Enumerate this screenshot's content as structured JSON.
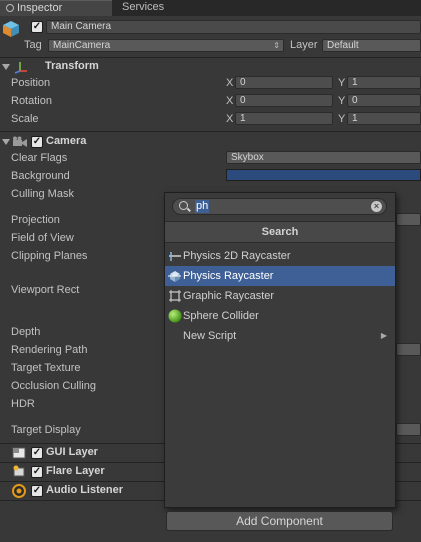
{
  "tabs": [
    {
      "label": "Inspector",
      "active": true
    },
    {
      "label": "Services",
      "active": false
    }
  ],
  "header": {
    "object_name": "Main Camera",
    "tag_label": "Tag",
    "tag_value": "MainCamera",
    "layer_label": "Layer",
    "layer_value": "Default"
  },
  "transform": {
    "title": "Transform",
    "rows": [
      {
        "label": "Position",
        "x_label": "X",
        "x": "0",
        "y_label": "Y",
        "y": "1"
      },
      {
        "label": "Rotation",
        "x_label": "X",
        "x": "0",
        "y_label": "Y",
        "y": "0"
      },
      {
        "label": "Scale",
        "x_label": "X",
        "x": "1",
        "y_label": "Y",
        "y": "1"
      }
    ]
  },
  "camera": {
    "title": "Camera",
    "clear_flags_label": "Clear Flags",
    "clear_flags_value": "Skybox",
    "background_label": "Background",
    "background_color": "#2a4b7c",
    "labels": {
      "culling_mask": "Culling Mask",
      "projection": "Projection",
      "field_of_view": "Field of View",
      "clipping_planes": "Clipping Planes",
      "viewport_rect": "Viewport Rect",
      "depth": "Depth",
      "rendering_path": "Rendering Path",
      "target_texture": "Target Texture",
      "occlusion_culling": "Occlusion Culling",
      "hdr": "HDR",
      "target_display": "Target Display"
    }
  },
  "components": {
    "gui_layer": "GUI Layer",
    "flare_layer": "Flare Layer",
    "audio_listener": "Audio Listener"
  },
  "popup": {
    "search_value": "ph",
    "heading": "Search",
    "items": [
      {
        "label": "Physics 2D Raycaster",
        "icon": "raycaster-2d-icon",
        "selected": false
      },
      {
        "label": "Physics Raycaster",
        "icon": "raycaster-icon",
        "selected": true
      },
      {
        "label": "Graphic Raycaster",
        "icon": "graphic-raycaster-icon",
        "selected": false
      },
      {
        "label": "Sphere Collider",
        "icon": "sphere-icon",
        "selected": false
      },
      {
        "label": "New Script",
        "icon": "",
        "selected": false,
        "has_submenu": true
      }
    ]
  },
  "add_component_label": "Add Component",
  "colors": {
    "selection": "#3e6096",
    "sphere_green": "#5fae25",
    "audio_orange": "#e39a1a"
  }
}
